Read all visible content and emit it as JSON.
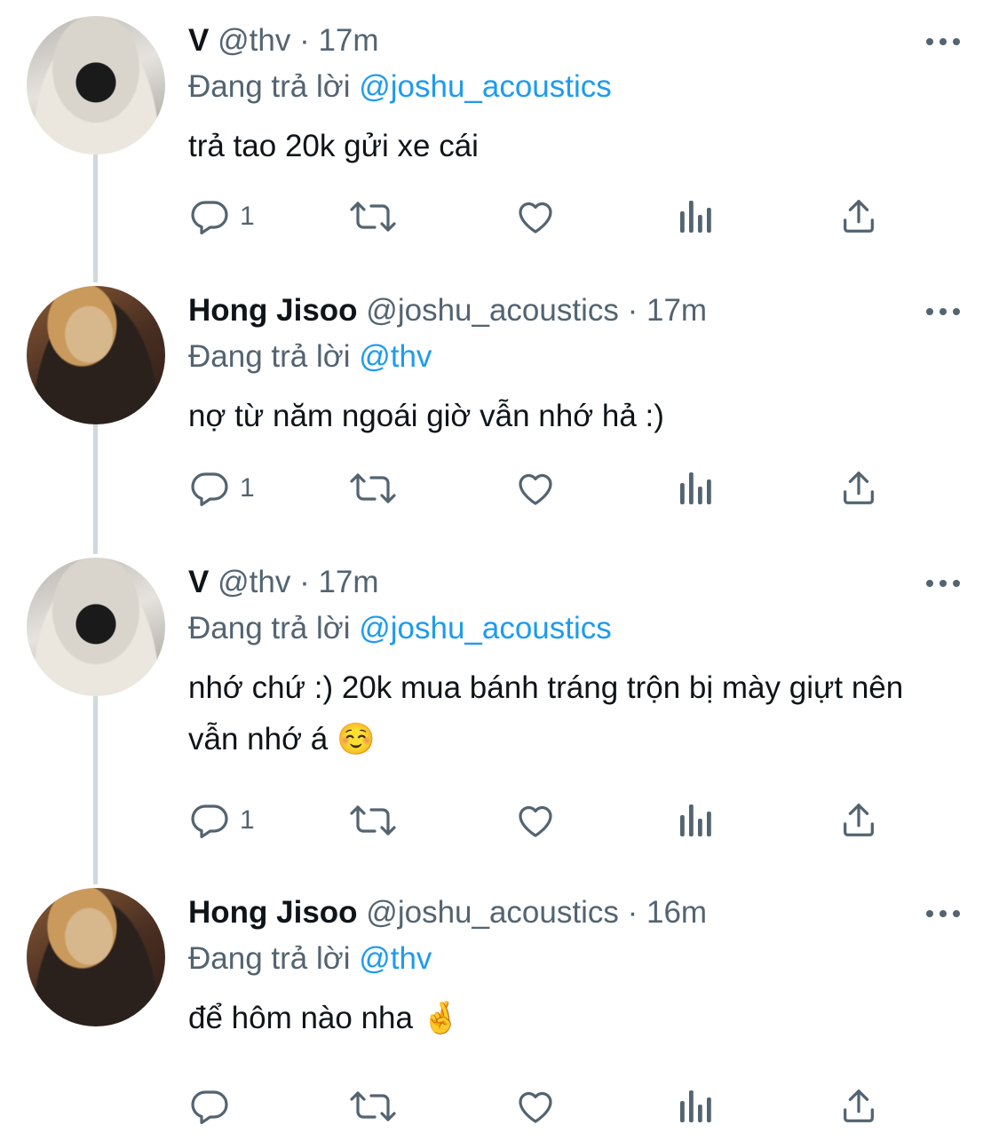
{
  "tweets": [
    {
      "name": "V",
      "handle": "@thv",
      "time": "· 17m",
      "reply_prefix": "Đang trả lời",
      "reply_to": "@joshu_acoustics",
      "text": "trả tao 20k gửi xe cái",
      "reply_count": "1",
      "avatar": "avatar-v"
    },
    {
      "name": "Hong Jisoo",
      "handle": "@joshu_acoustics",
      "time": "· 17m",
      "reply_prefix": "Đang trả lời",
      "reply_to": "@thv",
      "text": "nợ từ năm ngoái giờ vẫn nhớ hả :)",
      "reply_count": "1",
      "avatar": "avatar-hong-jisoo"
    },
    {
      "name": "V",
      "handle": "@thv",
      "time": "· 17m",
      "reply_prefix": "Đang trả lời",
      "reply_to": "@joshu_acoustics",
      "text": "nhớ chứ :) 20k mua bánh tráng trộn bị mày giựt nên vẫn nhớ á ☺️",
      "reply_count": "1",
      "avatar": "avatar-v"
    },
    {
      "name": "Hong Jisoo",
      "handle": "@joshu_acoustics",
      "time": "· 16m",
      "reply_prefix": "Đang trả lời",
      "reply_to": "@thv",
      "text": "để hôm nào nha 🤞",
      "reply_count": "",
      "avatar": "avatar-hong-jisoo"
    }
  ],
  "icons": {
    "reply": "reply-icon",
    "retweet": "retweet-icon",
    "like": "heart-icon",
    "views": "analytics-icon",
    "share": "share-icon",
    "more": "more-options-icon"
  },
  "colors": {
    "text": "#0f1419",
    "secondary": "#536471",
    "mention": "#1d9bf0",
    "thread_line": "#cfd9de"
  }
}
